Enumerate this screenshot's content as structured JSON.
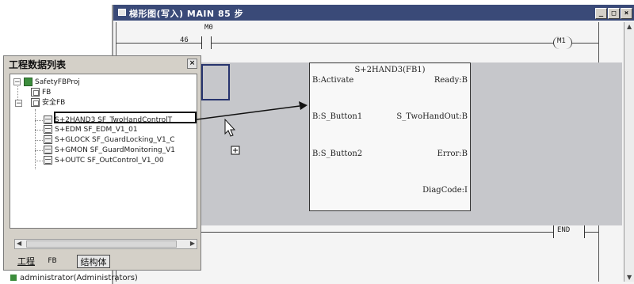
{
  "ladder_window": {
    "title": "梯形图(写入)  MAIN  85 步",
    "controls": {
      "minimize": "_",
      "restore": "□",
      "close": "×"
    },
    "rung1": {
      "step": "46",
      "contact": "M0",
      "coil": "M1"
    },
    "end_label": "END",
    "fb_block": {
      "title": "S+2HAND3(FB1)",
      "inputs": [
        "B:Activate",
        "B:S_Button1",
        "B:S_Button2"
      ],
      "outputs": [
        "Ready:B",
        "S_TwoHandOut:B",
        "Error:B",
        "DiagCode:I"
      ]
    }
  },
  "project_panel": {
    "title": "工程数据列表",
    "close": "×",
    "tree": {
      "project": "SafetyFBProj",
      "fb": "FB",
      "safety_fb": "安全FB",
      "items": [
        "S+2HAND3 SF_TwoHandControlT",
        "S+EDM SF_EDM_V1_01",
        "S+GLOCK SF_GuardLocking_V1_C",
        "S+GMON SF_GuardMonitoring_V1",
        "S+OUTC SF_OutControl_V1_00"
      ]
    },
    "tabs": [
      "工程",
      "FB",
      "结构体"
    ],
    "status": "administrator(Administrators)"
  },
  "colors": {
    "title_bar": "#3a4a78",
    "shade": "#c6c7cb",
    "selection": "#27346e"
  }
}
